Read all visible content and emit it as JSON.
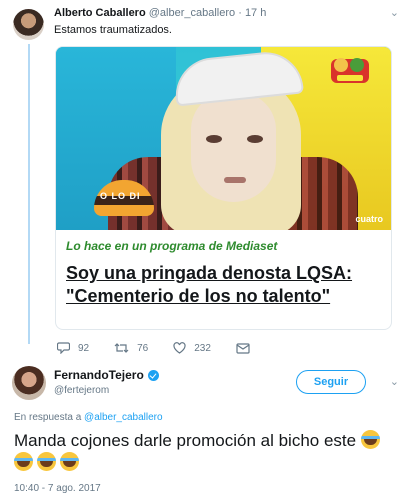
{
  "tweet1": {
    "name": "Alberto Caballero",
    "handle": "@alber_caballero",
    "separator": "·",
    "time": "17 h",
    "text": "Estamos traumatizados.",
    "card": {
      "image_watermark": "O LO DI",
      "channel_watermark": "cuatro",
      "tag": "Lo hace en un programa de Mediaset",
      "title": "Soy una pringada denosta LQSA: \"Cementerio de los no talento\""
    },
    "actions": {
      "replies": "92",
      "retweets": "76",
      "likes": "232"
    }
  },
  "tweet2": {
    "name": "FernandoTejero",
    "handle": "@fertejerom",
    "follow_label": "Seguir",
    "reply_prefix": "En respuesta a",
    "reply_mention": "@alber_caballero",
    "text": "Manda cojones darle promoción al bicho este",
    "emoji_count": 4,
    "timestamp": "10:40 - 7 ago. 2017"
  },
  "colors": {
    "accent": "#1da1f2",
    "tag_green": "#2e8b2e",
    "muted": "#657786"
  }
}
